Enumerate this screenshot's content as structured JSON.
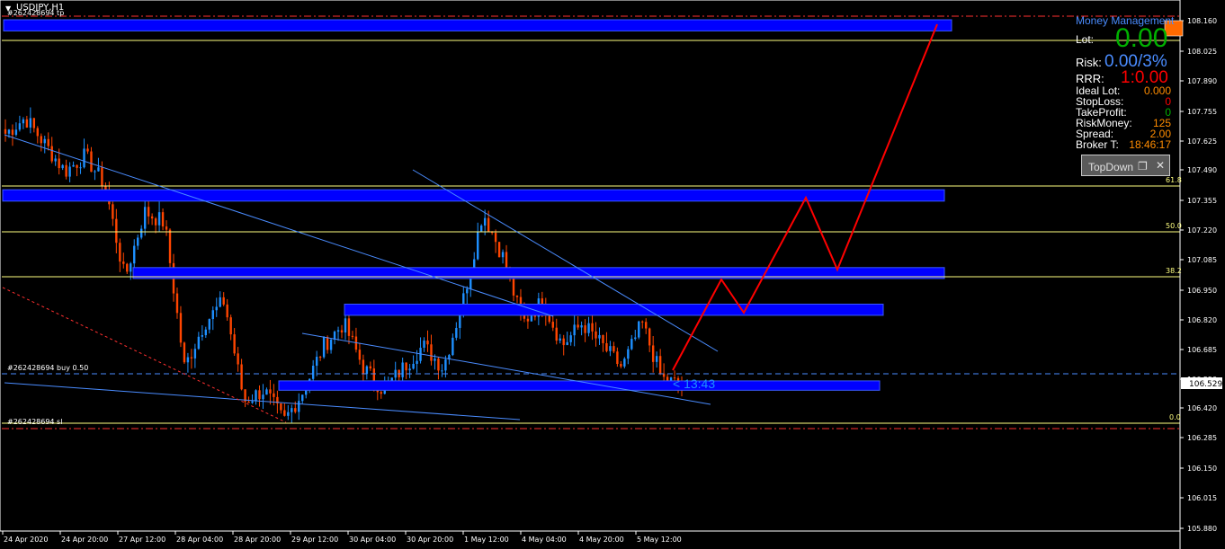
{
  "chart_header": {
    "symbol": "USDJPY,H1",
    "order_tp_label": "#262428694 tp",
    "order_buy_label": "#262428694 buy 0.50",
    "order_sl_label": "#262428694 sl",
    "countdown": "< 13:43",
    "current_price": "106.529"
  },
  "fib_levels": [
    "61.8",
    "50.0",
    "38.2",
    "0.0"
  ],
  "money_management": {
    "title": "Money Management",
    "lot_label": "Lot:",
    "lot_value": "0.00",
    "risk_label": "Risk:",
    "risk_value": "0.00/3%",
    "rrr_label": "RRR:",
    "rrr_value": "1:0.00",
    "rows": [
      {
        "label": "Ideal Lot:",
        "value": "0.000",
        "color": "#ff8c00"
      },
      {
        "label": "StopLoss:",
        "value": "0",
        "color": "#ff0000"
      },
      {
        "label": "TakeProfit:",
        "value": "0",
        "color": "#00b000"
      },
      {
        "label": "RiskMoney:",
        "value": "125",
        "color": "#ff8c00"
      },
      {
        "label": "Spread:",
        "value": "2.00",
        "color": "#ff8c00"
      },
      {
        "label": "Broker T:",
        "value": "18:46:17",
        "color": "#ff8c00"
      }
    ],
    "topdown_label": "TopDown"
  },
  "colors": {
    "background": "#000000",
    "bull_candle": "#1e90ff",
    "bear_candle": "#ff4500",
    "zone": "#0000ff",
    "fib": "#ffff80",
    "trendline": "#4a8cff",
    "projection": "#ff0000",
    "axis_text": "#ffffff"
  },
  "chart_data": {
    "type": "candlestick",
    "symbol": "USDJPY",
    "timeframe": "H1",
    "y_ticks": [
      "108.160",
      "108.025",
      "107.890",
      "107.755",
      "107.625",
      "107.490",
      "107.355",
      "107.220",
      "107.085",
      "106.950",
      "106.820",
      "106.685",
      "106.550",
      "106.420",
      "106.285",
      "106.150",
      "106.015",
      "105.880"
    ],
    "x_ticks": [
      "24 Apr 2020",
      "24 Apr 20:00",
      "27 Apr 12:00",
      "28 Apr 04:00",
      "28 Apr 20:00",
      "29 Apr 12:00",
      "30 Apr 04:00",
      "30 Apr 20:00",
      "1 May 12:00",
      "4 May 04:00",
      "4 May 20:00",
      "5 May 12:00"
    ],
    "ylim": [
      105.88,
      108.16
    ],
    "price_levels": {
      "take_profit": 108.12,
      "fib_61_8": 107.423,
      "fib_50_0": 107.22,
      "fib_38_2": 107.019,
      "entry_buy": 106.558,
      "current": 106.529,
      "fib_0_0": 106.332,
      "stop_loss": 106.317
    },
    "zones": [
      {
        "top": 108.16,
        "bottom": 108.11
      },
      {
        "top": 107.398,
        "bottom": 107.347
      },
      {
        "top": 107.049,
        "bottom": 107.0
      },
      {
        "top": 106.885,
        "bottom": 106.835
      },
      {
        "top": 106.541,
        "bottom": 106.499
      }
    ],
    "key_closes": [
      107.65,
      107.72,
      107.6,
      107.48,
      107.55,
      107.42,
      107.0,
      107.3,
      107.25,
      106.6,
      106.8,
      106.9,
      106.45,
      106.5,
      106.36,
      106.5,
      106.7,
      106.8,
      106.6,
      106.5,
      106.6,
      106.7,
      106.6,
      106.9,
      107.3,
      107.1,
      106.8,
      106.9,
      106.7,
      106.8,
      106.7,
      106.6,
      106.8,
      106.55,
      106.52
    ]
  }
}
